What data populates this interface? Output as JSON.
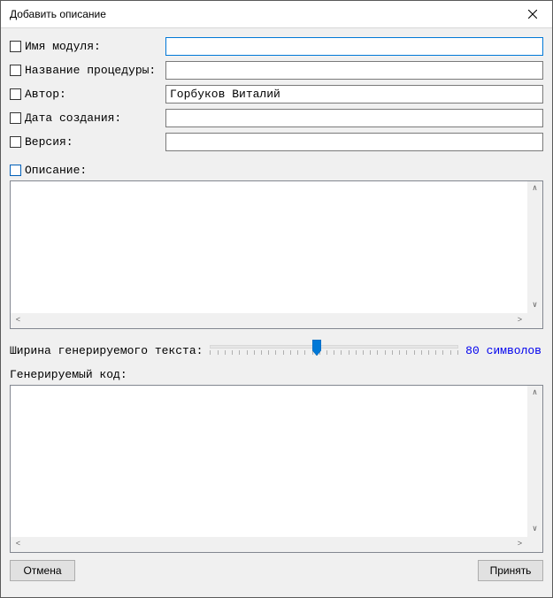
{
  "window": {
    "title": "Добавить описание"
  },
  "fields": {
    "module_name": {
      "label": "Имя модуля:",
      "value": ""
    },
    "proc_name": {
      "label": "Название процедуры:",
      "value": ""
    },
    "author": {
      "label": "Автор:",
      "value": "Горбуков Виталий"
    },
    "created": {
      "label": "Дата создания:",
      "value": ""
    },
    "version": {
      "label": "Версия:",
      "value": ""
    }
  },
  "description": {
    "label": "Описание:",
    "value": ""
  },
  "width_control": {
    "label": "Ширина генерируемого текста:",
    "value": 80,
    "unit": "символов",
    "min": 40,
    "max": 160,
    "pos_percent": 43
  },
  "generated": {
    "label": "Генерируемый код:",
    "value": ""
  },
  "buttons": {
    "cancel": "Отмена",
    "accept": "Принять"
  }
}
